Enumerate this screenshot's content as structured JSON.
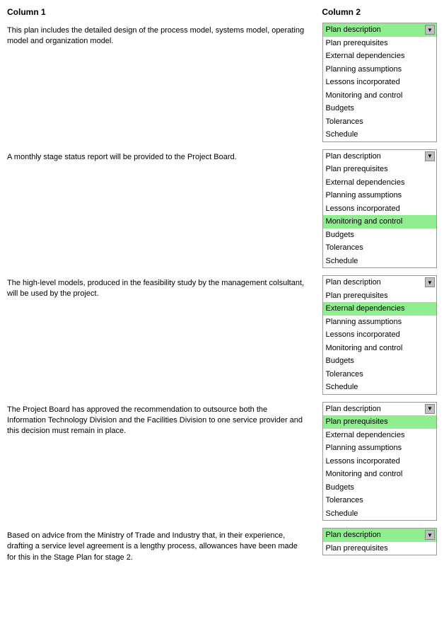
{
  "columns": {
    "col1_header": "Column 1",
    "col2_header": "Column 2"
  },
  "rows": [
    {
      "id": "row1",
      "col1_text": "This plan includes the detailed design of the process model, systems model, operating model and organization model.",
      "selected_item": "Plan description",
      "items": [
        "Plan description",
        "Plan prerequisites",
        "External dependencies",
        "Planning assumptions",
        "Lessons incorporated",
        "Monitoring and control",
        "Budgets",
        "Tolerances",
        "Schedule"
      ]
    },
    {
      "id": "row2",
      "col1_text": "A monthly stage status report will be provided to the Project Board.",
      "selected_item": "Monitoring and control",
      "items": [
        "Plan description",
        "Plan prerequisites",
        "External dependencies",
        "Planning assumptions",
        "Lessons incorporated",
        "Monitoring and control",
        "Budgets",
        "Tolerances",
        "Schedule"
      ]
    },
    {
      "id": "row3",
      "col1_text": "The high-level models, produced in the feasibility study by the management colsultant, will be used by the project.",
      "selected_item": "External dependencies",
      "items": [
        "Plan description",
        "Plan prerequisites",
        "External dependencies",
        "Planning assumptions",
        "Lessons incorporated",
        "Monitoring and control",
        "Budgets",
        "Tolerances",
        "Schedule"
      ]
    },
    {
      "id": "row4",
      "col1_text": "The Project Board has approved the recommendation to outsource both the Information Technology Division and the Facilities Division to one service provider and this decision must remain in place.",
      "selected_item": "Plan prerequisites",
      "items": [
        "Plan description",
        "Plan prerequisites",
        "External dependencies",
        "Planning assumptions",
        "Lessons incorporated",
        "Monitoring and control",
        "Budgets",
        "Tolerances",
        "Schedule"
      ]
    },
    {
      "id": "row5",
      "col1_text": "Based on advice from the Ministry of Trade and Industry that, in their experience, drafting a service level agreement is a lengthy process, allowances have been made for this in the Stage Plan for stage 2.",
      "selected_item": "Plan description",
      "items": [
        "Plan description",
        "Plan prerequisites"
      ]
    }
  ]
}
